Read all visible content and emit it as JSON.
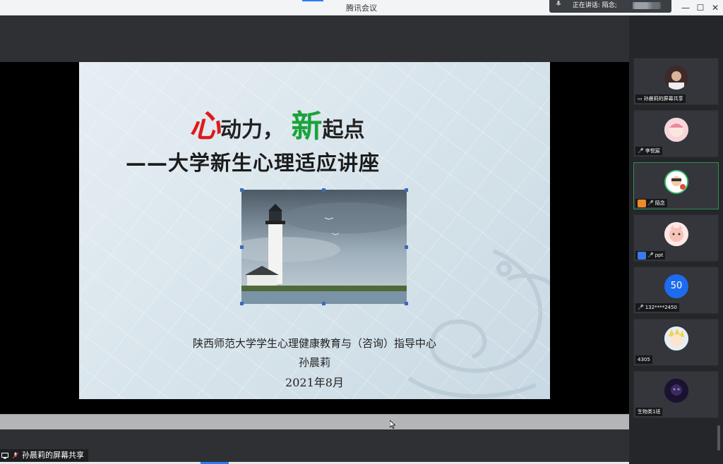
{
  "window": {
    "title": "腾讯会议",
    "minimize_glyph": "—",
    "maximize_glyph": "☐",
    "close_glyph": "✕"
  },
  "speaking": {
    "text": "正在讲话: 陌念;"
  },
  "slide": {
    "title_char_1": "心",
    "title_part_1": "动力，",
    "title_char_2": "新",
    "title_part_2": "起点",
    "subtitle": "——大学新生心理适应讲座",
    "organization": "陕西师范大学学生心理健康教育与（咨询）指导中心",
    "presenter": "孙晨莉",
    "date": "2021年8月"
  },
  "share_label": "孙晨莉的屏幕共享",
  "participants": [
    {
      "name": "孙晨莉的屏幕共享",
      "icon": "screen-share-icon"
    },
    {
      "name": "李悦宸",
      "icon": "mic-muted-icon"
    },
    {
      "name": "陌念",
      "icon": "mic-icon"
    },
    {
      "name": "ppt",
      "icon": "mic-muted-icon"
    },
    {
      "name": "132****2450",
      "avatar_text": "50",
      "icon": "mic-muted-icon"
    },
    {
      "name": "4305",
      "icon": ""
    },
    {
      "name": "生物类1班",
      "icon": ""
    }
  ],
  "colors": {
    "accent": "#2d7cf6",
    "title_red": "#e01a1a",
    "title_green": "#1aa33a",
    "active_tile_border": "#2f8f4e"
  }
}
